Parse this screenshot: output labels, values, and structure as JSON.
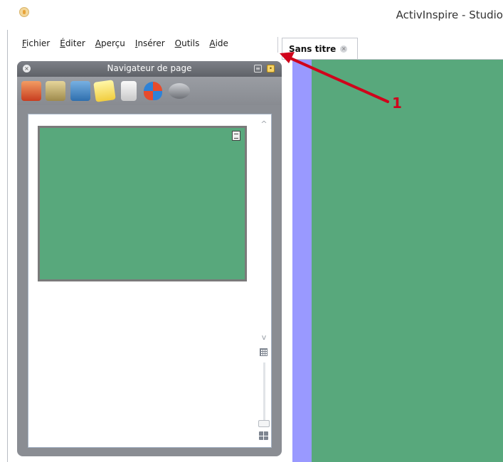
{
  "window": {
    "title": "ActivInspire - Studio"
  },
  "menu": {
    "items": [
      {
        "first": "F",
        "rest": "ichier"
      },
      {
        "first": "É",
        "rest": "diter"
      },
      {
        "first": "A",
        "rest": "perçu"
      },
      {
        "first": "I",
        "rest": "nsérer"
      },
      {
        "first": "O",
        "rest": "utils"
      },
      {
        "first": "A",
        "rest": "ide"
      }
    ]
  },
  "tab": {
    "label": "Sans titre",
    "close_glyph": "×"
  },
  "panel": {
    "title": "Navigateur de page",
    "close_glyph": "×",
    "toolbar_icons": [
      "page-browser-icon",
      "resource-browser-icon",
      "object-browser-icon",
      "notes-browser-icon",
      "property-browser-icon",
      "action-browser-icon",
      "voting-browser-icon"
    ]
  },
  "scroll": {
    "up_glyph": "^",
    "down_glyph": "v"
  },
  "annotation": {
    "number": "1",
    "color": "#d0021b"
  },
  "colors": {
    "canvas": "#58a87c",
    "gutter": "#9999ff",
    "panel": "#8a8d93"
  }
}
